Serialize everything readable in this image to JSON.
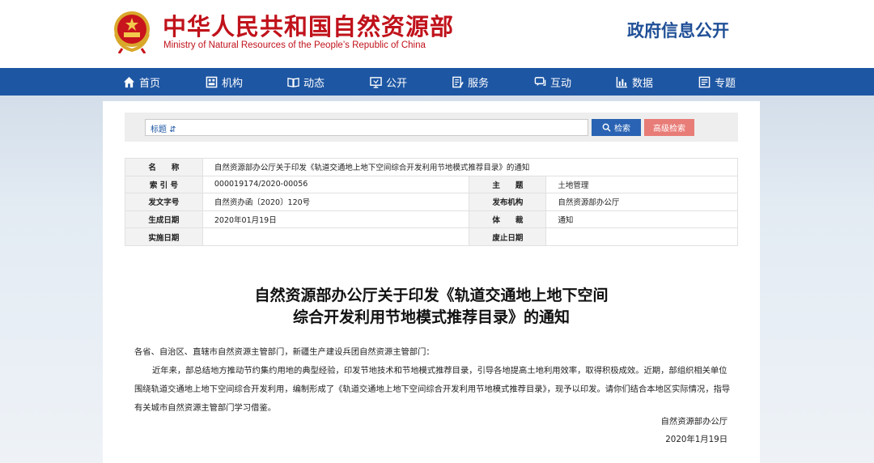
{
  "header": {
    "site_name_cn": "中华人民共和国自然资源部",
    "site_name_en": "Ministry of Natural Resources of the People’s Republic of China",
    "section": "政府信息公开"
  },
  "nav": [
    {
      "label": "首页",
      "icon": "home-icon"
    },
    {
      "label": "机构",
      "icon": "organization-icon"
    },
    {
      "label": "动态",
      "icon": "news-icon"
    },
    {
      "label": "公开",
      "icon": "disclosure-icon"
    },
    {
      "label": "服务",
      "icon": "service-icon"
    },
    {
      "label": "互动",
      "icon": "chat-icon"
    },
    {
      "label": "数据",
      "icon": "chart-icon"
    },
    {
      "label": "专题",
      "icon": "topic-icon"
    }
  ],
  "search": {
    "type_label": "标题",
    "value": "",
    "search_label": "检索",
    "advanced_label": "高级检索"
  },
  "meta": {
    "name_label": "名　　称",
    "name_value": "自然资源部办公厅关于印发《轨道交通地上地下空间综合开发利用节地模式推荐目录》的通知",
    "index_label": "索 引 号",
    "index_value": "000019174/2020-00056",
    "topic_label": "主　　题",
    "topic_value": "土地管理",
    "docno_label": "发文字号",
    "docno_value": "自然资办函〔2020〕120号",
    "issuer_label": "发布机构",
    "issuer_value": "自然资源部办公厅",
    "date_label": "生成日期",
    "date_value": "2020年01月19日",
    "genre_label": "体　　裁",
    "genre_value": "通知",
    "effective_label": "实施日期",
    "effective_value": "",
    "repeal_label": "废止日期",
    "repeal_value": ""
  },
  "document": {
    "title_line1": "自然资源部办公厅关于印发《轨道交通地上地下空间",
    "title_line2": "综合开发利用节地模式推荐目录》的通知",
    "salutation": "各省、自治区、直辖市自然资源主管部门，新疆生产建设兵团自然资源主管部门：",
    "body": "近年来，部总结地方推动节约集约用地的典型经验，印发节地技术和节地模式推荐目录，引导各地提高土地利用效率，取得积极成效。近期，部组织相关单位围绕轨道交通地上地下空间综合开发利用，编制形成了《轨道交通地上地下空间综合开发利用节地模式推荐目录》，现予以印发。请你们结合本地区实际情况，指导有关城市自然资源主管部门学习借鉴。",
    "signature": "自然资源部办公厅",
    "date": "2020年1月19日"
  },
  "colors": {
    "brand_red": "#c0121b",
    "nav_blue": "#1d56a3",
    "search_blue": "#2a63b3",
    "advanced_pink": "#e87c77"
  }
}
